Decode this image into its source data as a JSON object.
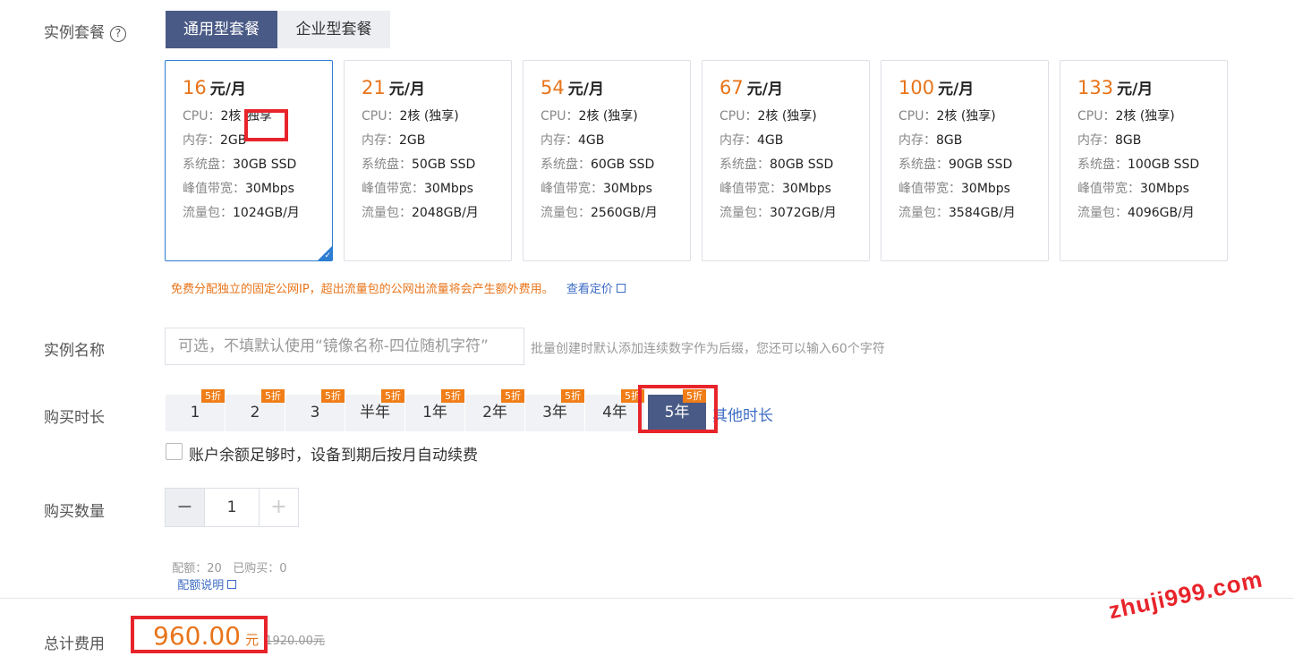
{
  "instance_plan": {
    "label": "实例套餐",
    "help_icon": "?",
    "tabs": [
      "通用型套餐",
      "企业型套餐"
    ],
    "active_tab": 0,
    "unit": "元/月",
    "spec_keys": {
      "cpu": "CPU：",
      "mem": "内存：",
      "disk": "系统盘：",
      "bw": "峰值带宽：",
      "traffic": "流量包："
    },
    "cards": [
      {
        "price": "16",
        "cpu": "2核 (独享)",
        "mem": "2GB",
        "disk": "30GB SSD",
        "bw": "30Mbps",
        "traffic": "1024GB/月",
        "selected": true
      },
      {
        "price": "21",
        "cpu": "2核 (独享)",
        "mem": "2GB",
        "disk": "50GB SSD",
        "bw": "30Mbps",
        "traffic": "2048GB/月",
        "selected": false
      },
      {
        "price": "54",
        "cpu": "2核 (独享)",
        "mem": "4GB",
        "disk": "60GB SSD",
        "bw": "30Mbps",
        "traffic": "2560GB/月",
        "selected": false
      },
      {
        "price": "67",
        "cpu": "2核 (独享)",
        "mem": "4GB",
        "disk": "80GB SSD",
        "bw": "30Mbps",
        "traffic": "3072GB/月",
        "selected": false
      },
      {
        "price": "100",
        "cpu": "2核 (独享)",
        "mem": "8GB",
        "disk": "90GB SSD",
        "bw": "30Mbps",
        "traffic": "3584GB/月",
        "selected": false
      },
      {
        "price": "133",
        "cpu": "2核 (独享)",
        "mem": "8GB",
        "disk": "100GB SSD",
        "bw": "30Mbps",
        "traffic": "4096GB/月",
        "selected": false
      }
    ],
    "first_card_cpu_prefix": "2核 ",
    "first_card_cpu_highlight": "独享",
    "note": "免费分配独立的固定公网IP，超出流量包的公网出流量将会产生额外费用。",
    "pricing_link": "查看定价"
  },
  "instance_name": {
    "label": "实例名称",
    "placeholder": "可选，不填默认使用“镜像名称-四位随机字符”",
    "hint": "批量创建时默认添加连续数字作为后缀，您还可以输入60个字符"
  },
  "duration": {
    "label": "购买时长",
    "options": [
      {
        "label": "1",
        "badge": "5折"
      },
      {
        "label": "2",
        "badge": "5折"
      },
      {
        "label": "3",
        "badge": "5折"
      },
      {
        "label": "半年",
        "badge": "5折"
      },
      {
        "label": "1年",
        "badge": "5折"
      },
      {
        "label": "2年",
        "badge": "5折"
      },
      {
        "label": "3年",
        "badge": "5折"
      },
      {
        "label": "4年",
        "badge": "5折"
      },
      {
        "label": "5年",
        "badge": "5折",
        "active": true
      }
    ],
    "other_link": "其他时长",
    "auto_renew": "账户余额足够时，设备到期后按月自动续费"
  },
  "quantity": {
    "label": "购买数量",
    "minus": "−",
    "value": "1",
    "plus": "+",
    "quota_text": "配额：20   已购买：0",
    "quota_link": "配额说明"
  },
  "total": {
    "label": "总计费用",
    "amount": "960.00",
    "currency": "元",
    "original": "1920.00元"
  },
  "watermark": "zhuji999.com",
  "colors": {
    "accent": "#e8741a",
    "primary": "#4a5a86",
    "link": "#3c6bc4",
    "highlight": "#e8242b"
  }
}
